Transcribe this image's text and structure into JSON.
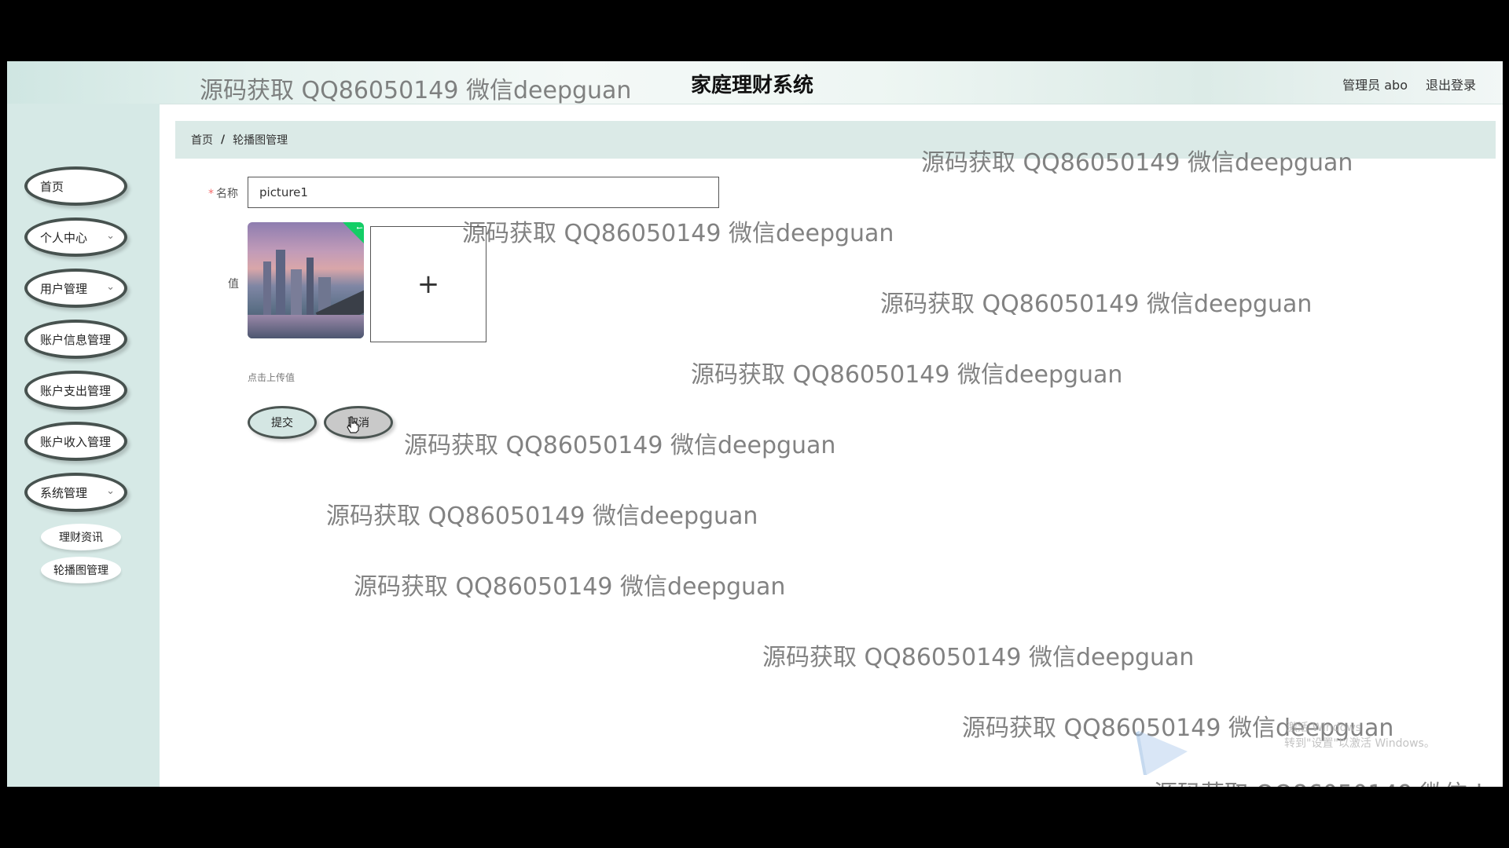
{
  "header": {
    "title": "家庭理财系统",
    "user_label": "管理员 abo",
    "logout_label": "退出登录"
  },
  "sidebar": {
    "items": [
      {
        "label": "首页",
        "has_chevron": false
      },
      {
        "label": "个人中心",
        "has_chevron": true
      },
      {
        "label": "用户管理",
        "has_chevron": true
      },
      {
        "label": "账户信息管理",
        "has_chevron": false
      },
      {
        "label": "账户支出管理",
        "has_chevron": false
      },
      {
        "label": "账户收入管理",
        "has_chevron": false
      },
      {
        "label": "系统管理",
        "has_chevron": true
      }
    ],
    "sub_items": [
      {
        "label": "理财资讯"
      },
      {
        "label": "轮播图管理"
      }
    ],
    "chevron_glyph": "⌄"
  },
  "breadcrumb": {
    "home": "首页",
    "separator": "/",
    "current": "轮播图管理"
  },
  "form": {
    "name_label": "名称",
    "required_mark": "*",
    "name_value": "picture1",
    "value_label": "值",
    "upload_plus": "+",
    "upload_hint": "点击上传值",
    "submit_label": "提交",
    "cancel_label": "取消"
  },
  "watermark": {
    "text": "源码获取 QQ86050149 微信deepguan"
  },
  "overlay": {
    "faint_line1": "激活 Windows",
    "faint_line2": "转到\"设置\"以激活 Windows。"
  },
  "colors": {
    "sidebar_bg": "#d6e9e6",
    "breadcrumb_bg": "#dbeae7",
    "nav_border": "#47524f",
    "required": "#f56c6c",
    "success": "#13ce66"
  }
}
